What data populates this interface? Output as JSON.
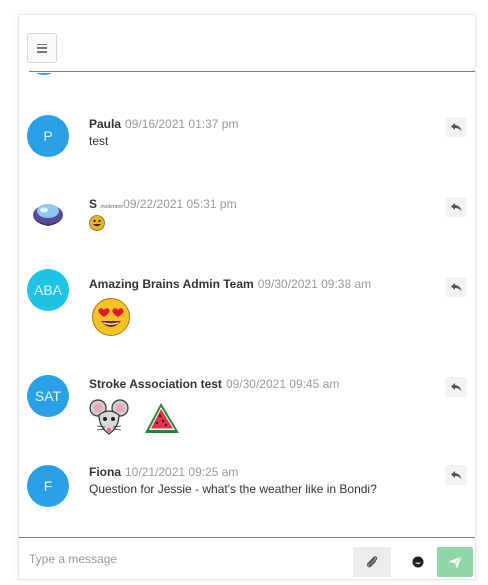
{
  "messages": [
    {
      "avatar_initials": "P",
      "author": "Paula",
      "role": "",
      "time": "09/16/2021 01:37 pm",
      "text": "test",
      "emojis": []
    },
    {
      "avatar_initials": "",
      "author": "S",
      "role": "moderator",
      "time": "09/22/2021 05:31 pm",
      "text": "",
      "emojis": [
        "grinning-face-emoji"
      ]
    },
    {
      "avatar_initials": "ABA",
      "author": "Amazing Brains Admin Team",
      "role": "",
      "time": "09/30/2021 09:38 am",
      "text": "",
      "emojis": [
        "heart-eyes-emoji"
      ]
    },
    {
      "avatar_initials": "SAT",
      "author": "Stroke Association test",
      "role": "",
      "time": "09/30/2021 09:45 am",
      "text": "",
      "emojis": [
        "mouse-face-emoji",
        "watermelon-emoji"
      ]
    },
    {
      "avatar_initials": "F",
      "author": "Fiona",
      "role": "",
      "time": "10/21/2021 09:25 am",
      "text": "Question for Jessie - what's the weather like in Bondi?",
      "emojis": []
    }
  ],
  "composer": {
    "placeholder": "Type a message"
  },
  "colors": {
    "avatar": "#2aa0e8",
    "send_button": "#8fd6a8",
    "timestamp": "#9a9a9a"
  },
  "icons": {
    "menu": "hamburger-menu-icon",
    "reply": "reply-icon",
    "attach": "paperclip-icon",
    "emoji": "emoji-icon",
    "send": "send-icon"
  }
}
